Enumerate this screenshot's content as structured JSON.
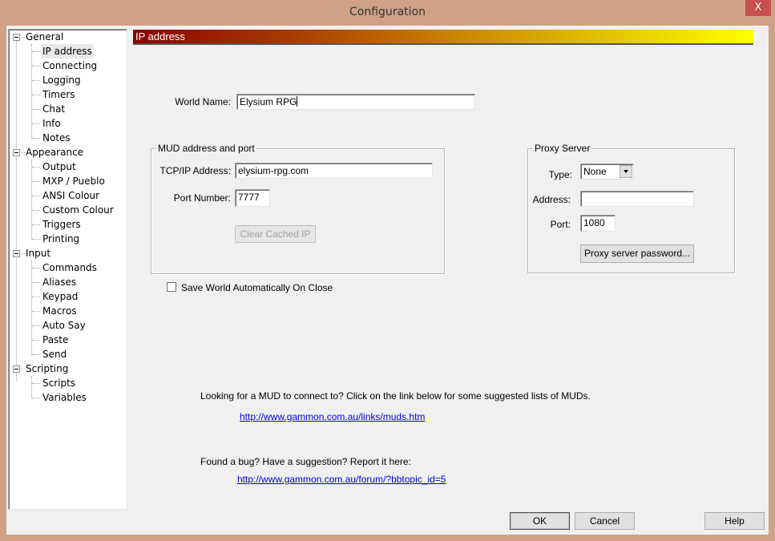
{
  "window": {
    "title": "Configuration",
    "close_label": "X"
  },
  "tree": {
    "groups": [
      {
        "label": "General",
        "children": [
          "IP address",
          "Connecting",
          "Logging",
          "Timers",
          "Chat",
          "Info",
          "Notes"
        ]
      },
      {
        "label": "Appearance",
        "children": [
          "Output",
          "MXP / Pueblo",
          "ANSI Colour",
          "Custom Colour",
          "Triggers",
          "Printing"
        ]
      },
      {
        "label": "Input",
        "children": [
          "Commands",
          "Aliases",
          "Keypad",
          "Macros",
          "Auto Say",
          "Paste",
          "Send"
        ]
      },
      {
        "label": "Scripting",
        "children": [
          "Scripts",
          "Variables"
        ]
      }
    ],
    "selected": "IP address"
  },
  "header": {
    "title": "IP address",
    "gradient_start": "#8b0000",
    "gradient_end": "#ffff00"
  },
  "form": {
    "world_name_label": "World Name:",
    "world_name_value": "Elysium RPG",
    "mud_group_title": "MUD address and port",
    "tcpip_label": "TCP/IP Address:",
    "tcpip_value": "elysium-rpg.com",
    "port_label": "Port Number:",
    "port_value": "7777",
    "clear_cached_ip_label": "Clear Cached IP",
    "save_world_label": "Save World Automatically On Close",
    "save_world_checked": false
  },
  "proxy": {
    "group_title": "Proxy Server",
    "type_label": "Type:",
    "type_value": "None",
    "address_label": "Address:",
    "address_value": "",
    "port_label": "Port:",
    "port_value": "1080",
    "password_button_label": "Proxy server password..."
  },
  "info": {
    "mud_list_text": "Looking for a MUD to connect to? Click on the link below for some suggested lists of MUDs.",
    "mud_list_link": "http://www.gammon.com.au/links/muds.htm",
    "bug_text": "Found a bug? Have a suggestion? Report it here:",
    "bug_link": "http://www.gammon.com.au/forum/?bbtopic_id=5"
  },
  "footer": {
    "ok_label": "OK",
    "cancel_label": "Cancel",
    "help_label": "Help"
  }
}
